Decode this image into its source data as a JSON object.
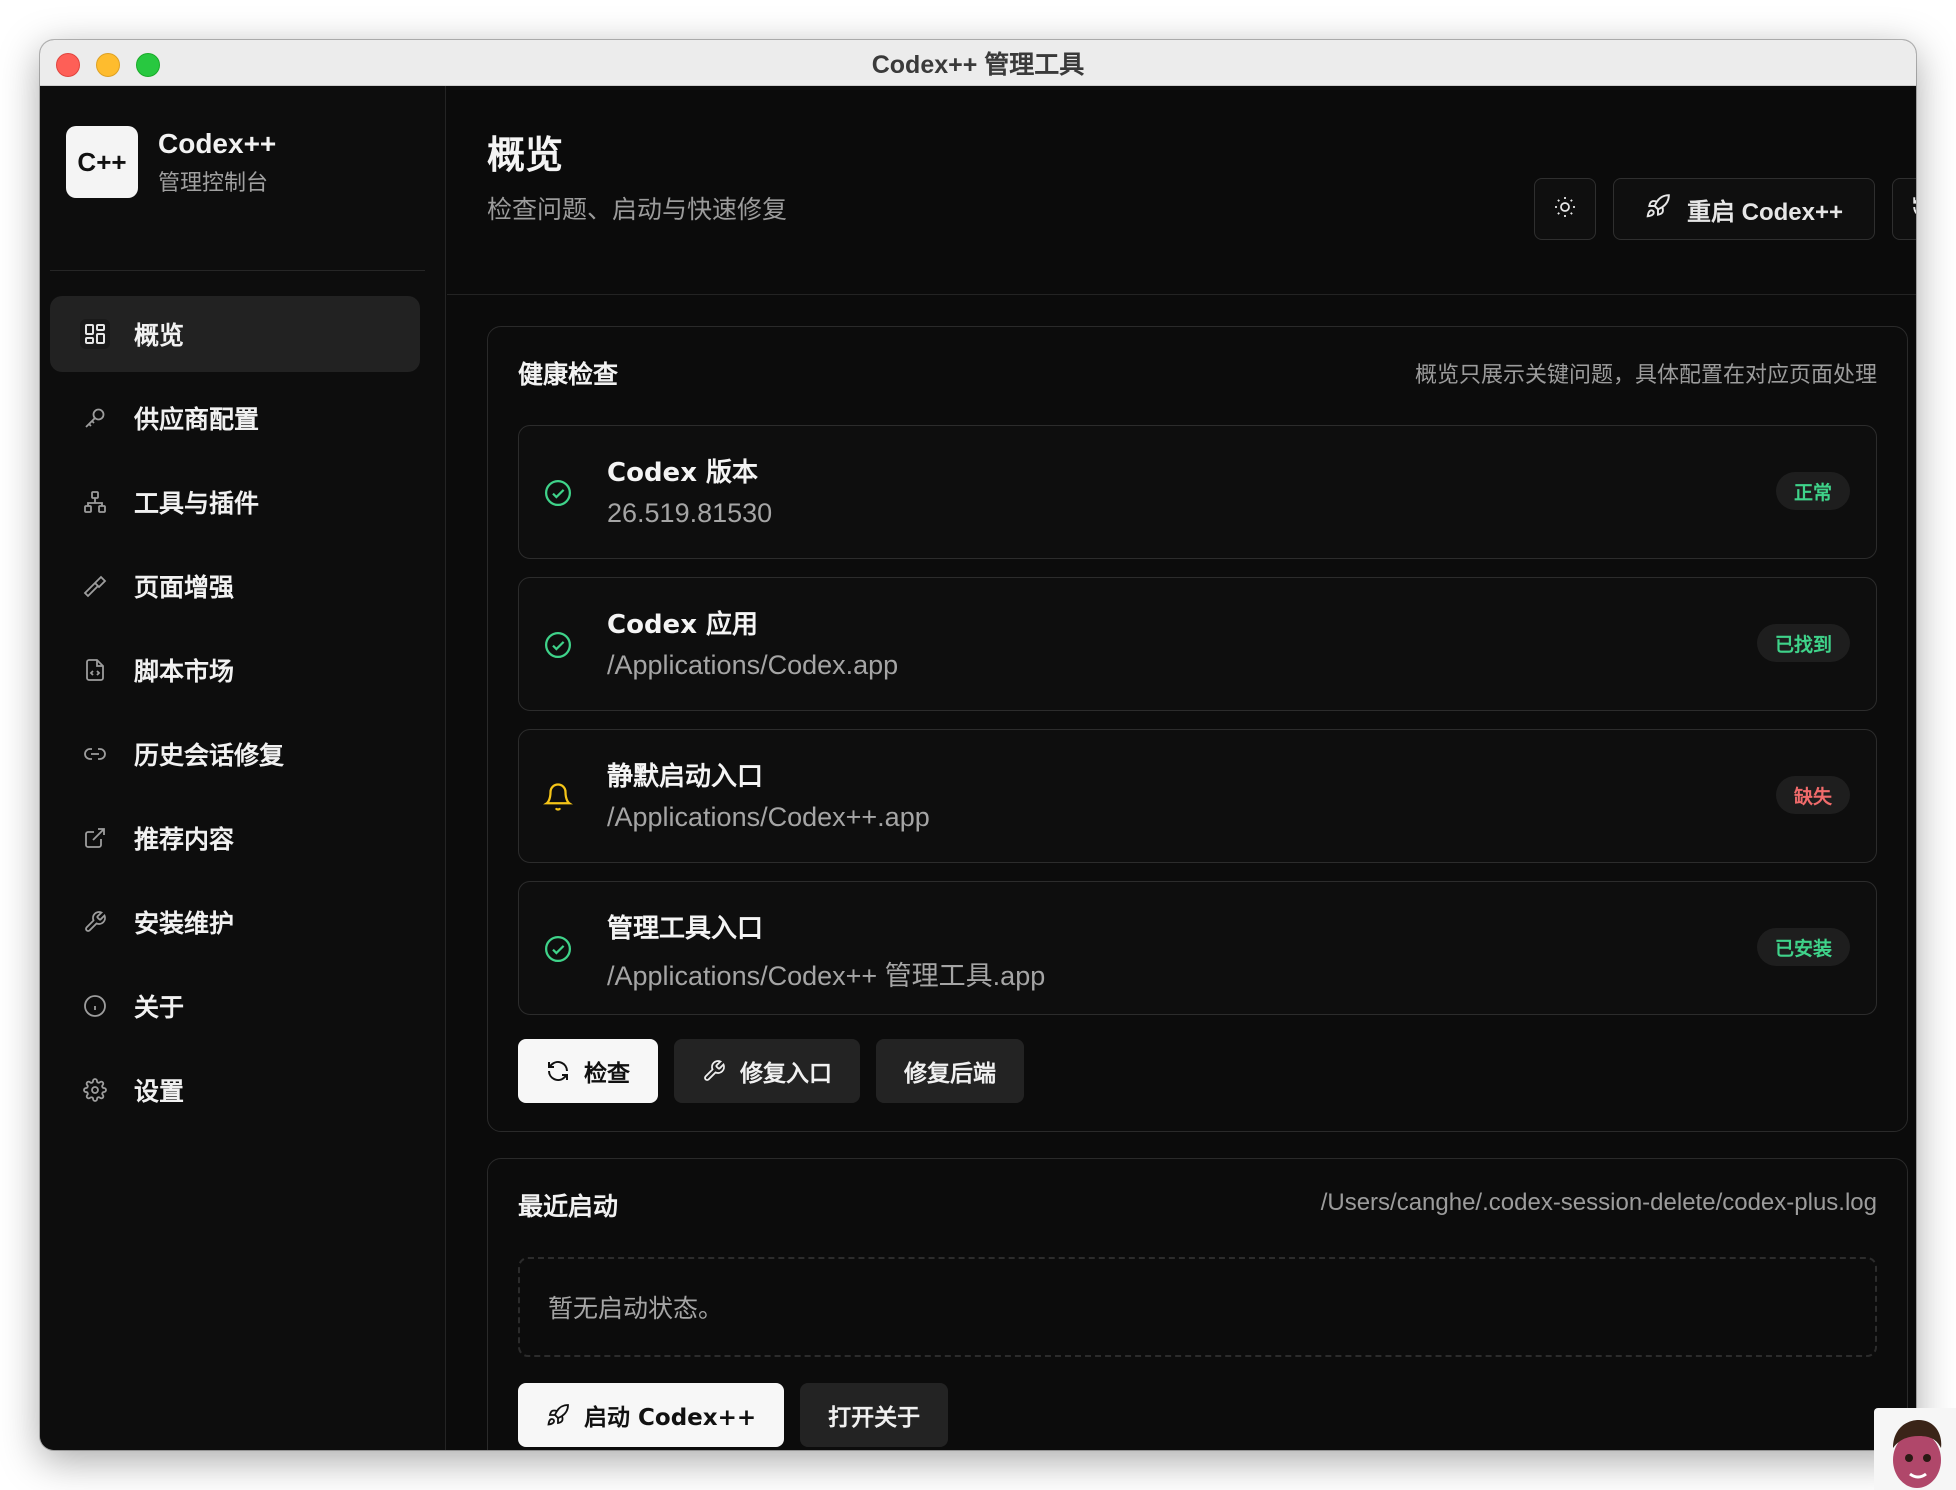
{
  "window": {
    "title": "Codex++ 管理工具"
  },
  "brand": {
    "logo_text": "C++",
    "name": "Codex++",
    "subtitle": "管理控制台"
  },
  "sidebar": {
    "items": [
      {
        "label": "概览",
        "icon": "grid-icon",
        "active": true
      },
      {
        "label": "供应商配置",
        "icon": "key-icon"
      },
      {
        "label": "工具与插件",
        "icon": "network-icon"
      },
      {
        "label": "页面增强",
        "icon": "hammer-icon"
      },
      {
        "label": "脚本市场",
        "icon": "file-code-icon"
      },
      {
        "label": "历史会话修复",
        "icon": "link-icon"
      },
      {
        "label": "推荐内容",
        "icon": "external-link-icon"
      },
      {
        "label": "安装维护",
        "icon": "wrench-icon"
      },
      {
        "label": "关于",
        "icon": "info-icon"
      },
      {
        "label": "设置",
        "icon": "gear-icon"
      }
    ]
  },
  "header": {
    "title": "概览",
    "subtitle": "检查问题、启动与快速修复",
    "restart_label": "重启 Codex++"
  },
  "health": {
    "title": "健康检查",
    "note": "概览只展示关键问题，具体配置在对应页面处理",
    "items": [
      {
        "name": "Codex 版本",
        "value": "26.519.81530",
        "status": "正常",
        "state": "ok"
      },
      {
        "name": "Codex 应用",
        "value": "/Applications/Codex.app",
        "status": "已找到",
        "state": "ok"
      },
      {
        "name": "静默启动入口",
        "value": "/Applications/Codex++.app",
        "status": "缺失",
        "state": "missing"
      },
      {
        "name": "管理工具入口",
        "value": "/Applications/Codex++ 管理工具.app",
        "status": "已安装",
        "state": "ok"
      }
    ],
    "buttons": {
      "check": "检查",
      "repair_entry": "修复入口",
      "repair_backend": "修复后端"
    }
  },
  "recent": {
    "title": "最近启动",
    "log_path": "/Users/canghe/.codex-session-delete/codex-plus.log",
    "empty": "暂无启动状态。",
    "buttons": {
      "launch": "启动 Codex++",
      "open_about": "打开关于"
    }
  },
  "colors": {
    "ok": "#3fd38a",
    "warn": "#f5c518",
    "missing": "#f06b6b",
    "background": "#0b0b0b"
  }
}
